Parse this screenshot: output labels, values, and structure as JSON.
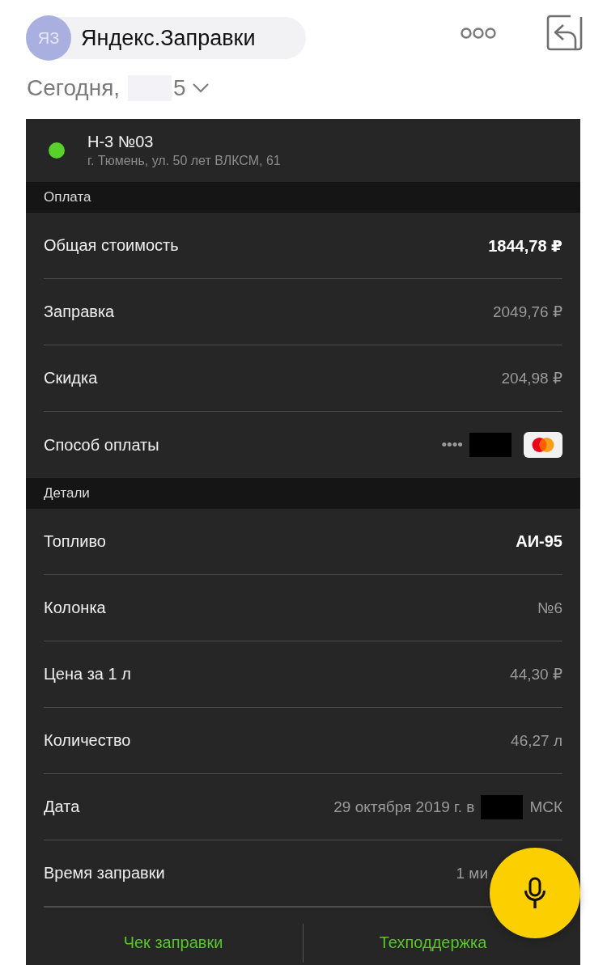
{
  "app_bar": {
    "avatar": "ЯЗ",
    "title": "Яндекс.Заправки"
  },
  "date_selector": {
    "label_start": "Сегодня,",
    "redacted": true,
    "label_end": "5",
    "expanded": false
  },
  "station": {
    "color": "#58d22a",
    "name": "Н-3 №03",
    "address": "г. Тюмень, ул. 50 лет ВЛКСМ, 61"
  },
  "sections": [
    {
      "title": "Оплата",
      "rows": [
        {
          "label": "Общая стоимость",
          "emphasized": true,
          "parts": [
            {
              "kind": "text",
              "text": "1844,78 ₽"
            }
          ]
        },
        {
          "label": "Заправка",
          "emphasized": false,
          "parts": [
            {
              "kind": "text",
              "text": "2049,76 ₽"
            }
          ]
        },
        {
          "label": "Скидка",
          "emphasized": false,
          "parts": [
            {
              "kind": "text",
              "text": "204,98 ₽"
            }
          ]
        },
        {
          "label": "Способ оплаты",
          "emphasized": false,
          "parts": [
            {
              "kind": "text",
              "text": "••••"
            },
            {
              "kind": "redacted"
            },
            {
              "kind": "card_logo"
            }
          ]
        }
      ]
    },
    {
      "title": "Детали",
      "rows": [
        {
          "label": "Топливо",
          "emphasized": true,
          "parts": [
            {
              "kind": "text",
              "text": "АИ-95"
            }
          ]
        },
        {
          "label": "Колонка",
          "emphasized": false,
          "parts": [
            {
              "kind": "text",
              "text": "№6"
            }
          ]
        },
        {
          "label": "Цена за 1 л",
          "emphasized": false,
          "parts": [
            {
              "kind": "text",
              "text": "44,30 ₽"
            }
          ]
        },
        {
          "label": "Количество",
          "emphasized": false,
          "parts": [
            {
              "kind": "text",
              "text": "46,27 л"
            }
          ]
        },
        {
          "label": "Дата",
          "emphasized": false,
          "parts": [
            {
              "kind": "text",
              "text": "29 октября 2019 г. в"
            },
            {
              "kind": "redacted"
            },
            {
              "kind": "text",
              "text": "МСК"
            }
          ]
        },
        {
          "label": "Время заправки",
          "emphasized": false,
          "parts": [
            {
              "kind": "text",
              "text": "1 ми"
            }
          ]
        }
      ]
    }
  ],
  "footer_buttons": [
    "Чек заправки",
    "Техподдержка"
  ]
}
